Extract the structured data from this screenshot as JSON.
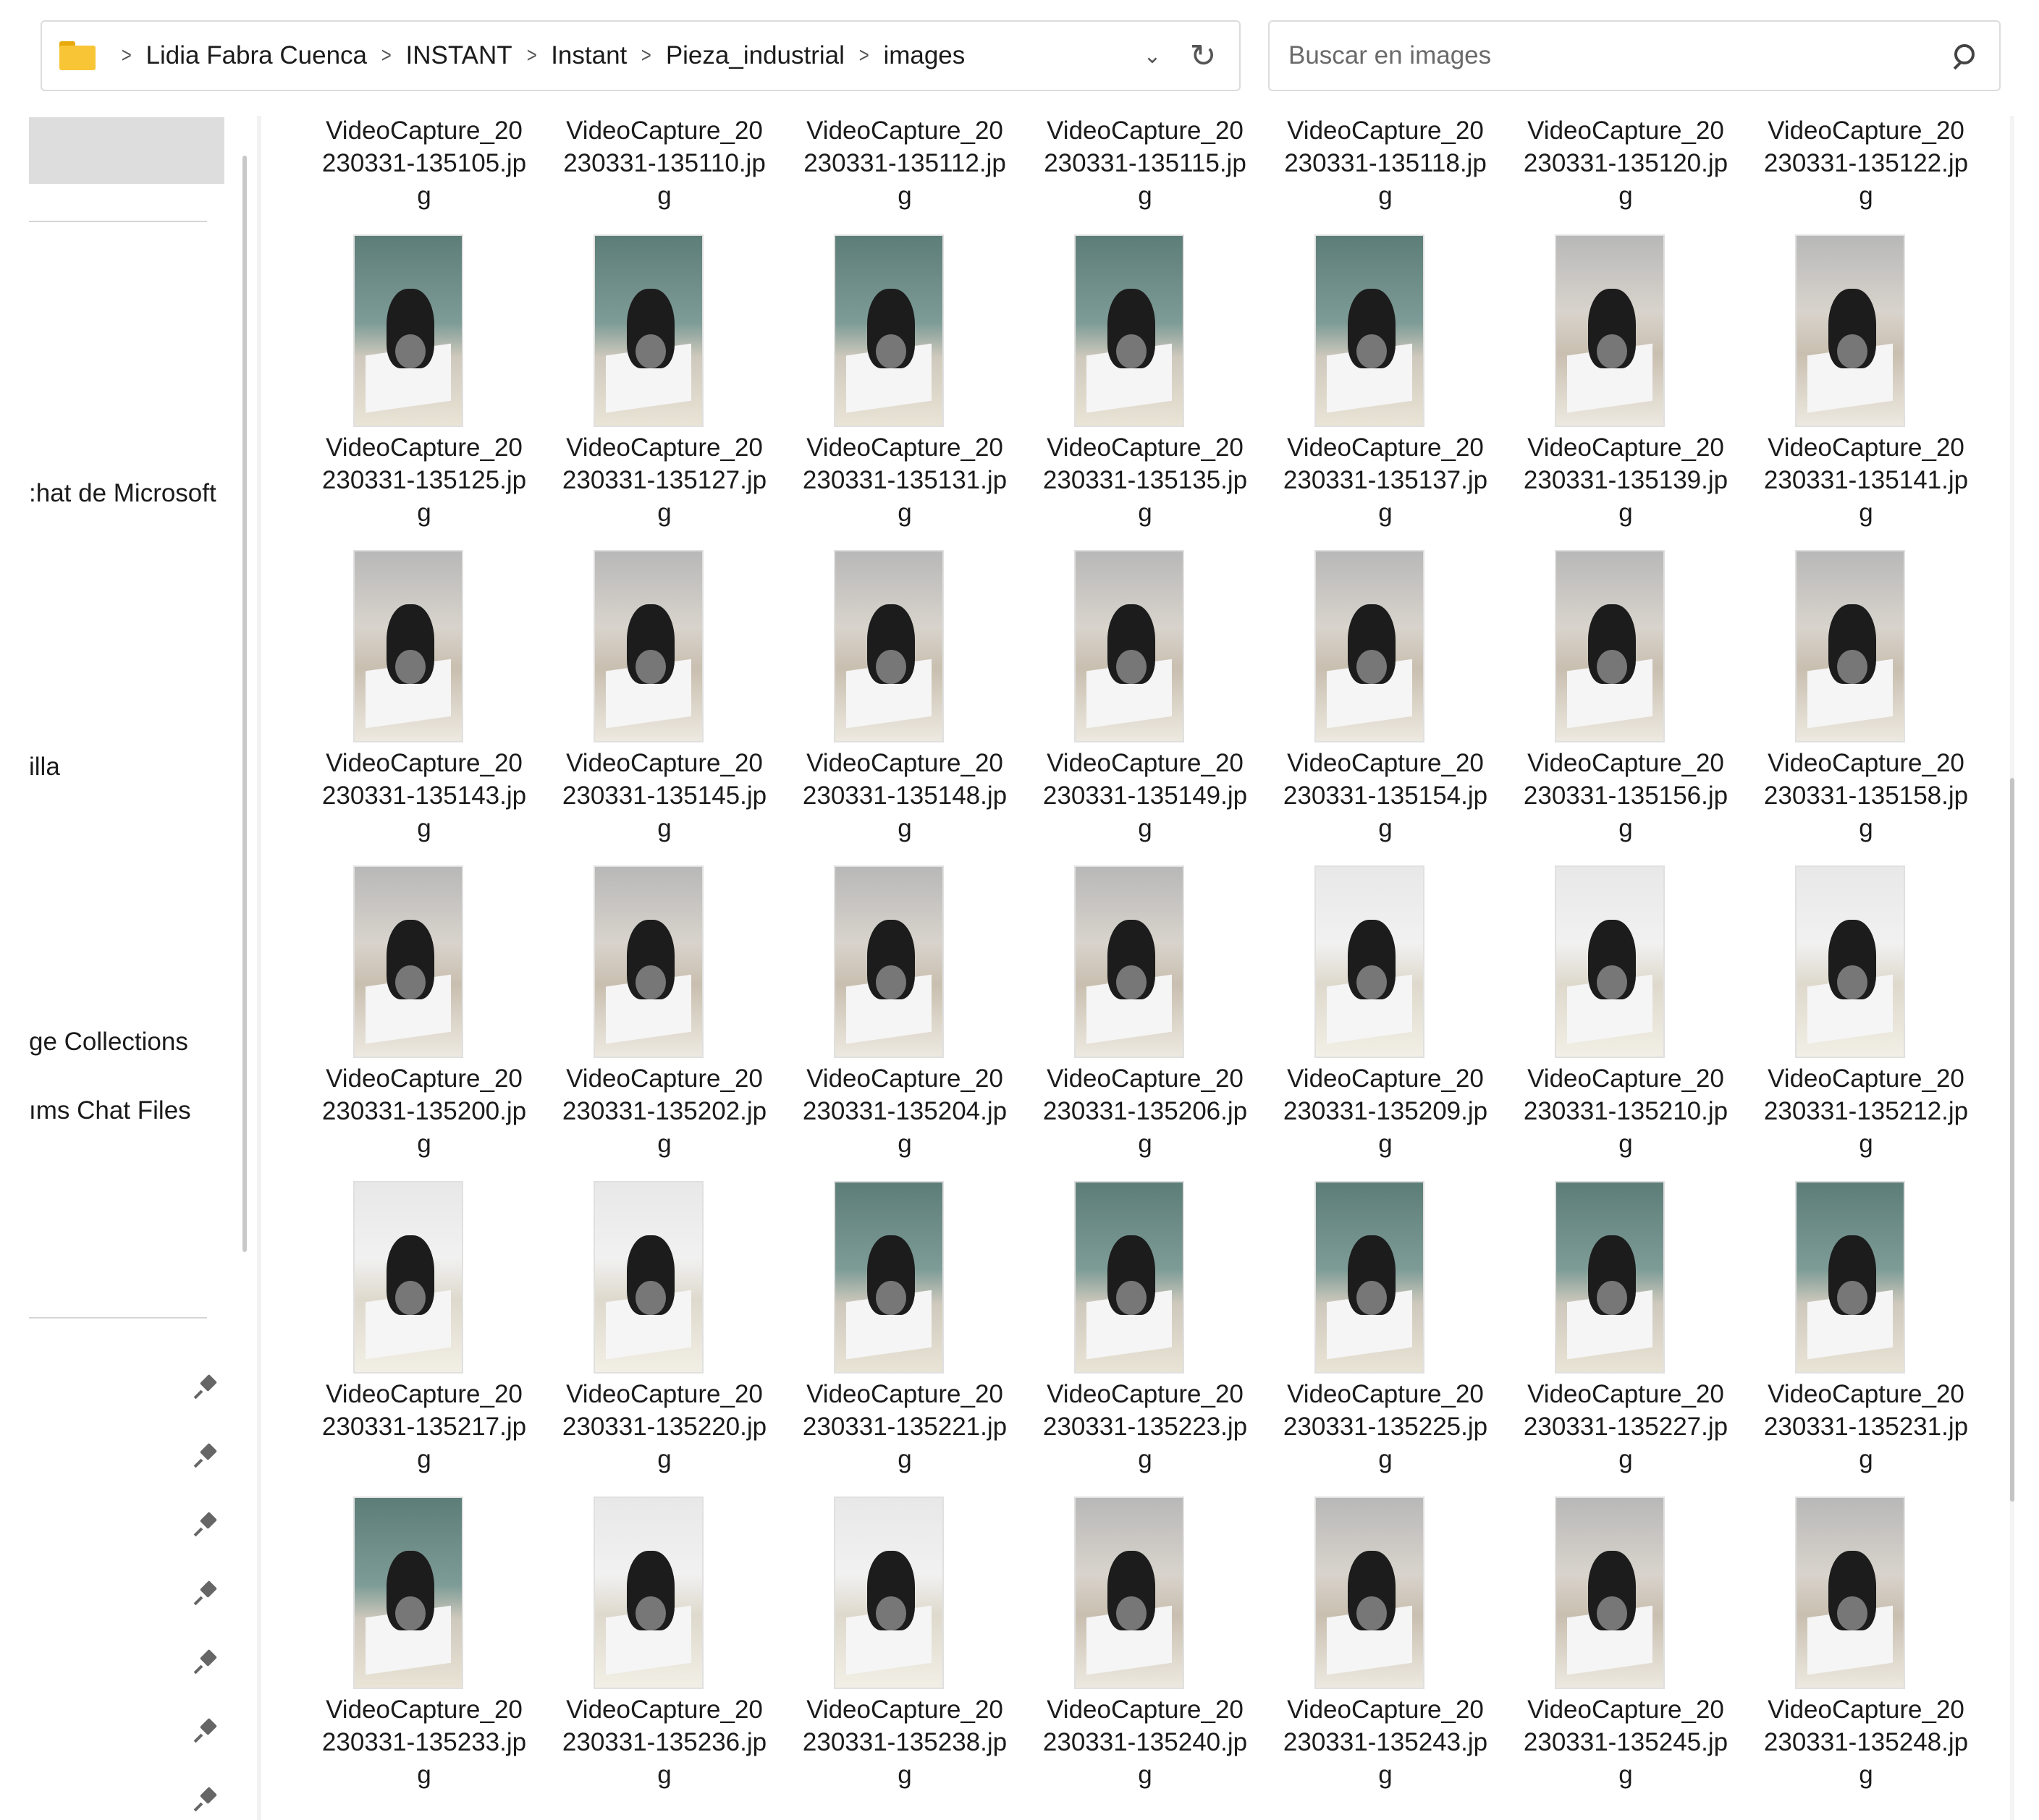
{
  "address": {
    "crumbs": [
      "Lidia Fabra Cuenca",
      "INSTANT",
      "Instant",
      "Pieza_industrial",
      "images"
    ]
  },
  "search": {
    "placeholder": "Buscar en images"
  },
  "sidebar": {
    "items": [
      {
        "label": ":hat de Microsoft",
        "top": 0
      },
      {
        "label": "illa",
        "top": 0
      },
      {
        "label": "ge Collections",
        "top": 0
      },
      {
        "label": "ıms Chat Files",
        "top": 0
      }
    ]
  },
  "files": {
    "top_row": [
      "VideoCapture_20\n230331-135105.jp\ng",
      "VideoCapture_20\n230331-135110.jp\ng",
      "VideoCapture_20\n230331-135112.jp\ng",
      "VideoCapture_20\n230331-135115.jp\ng",
      "VideoCapture_20\n230331-135118.jp\ng",
      "VideoCapture_20\n230331-135120.jp\ng",
      "VideoCapture_20\n230331-135122.jp\ng"
    ],
    "rows": [
      [
        "VideoCapture_20\n230331-135125.jp\ng",
        "VideoCapture_20\n230331-135127.jp\ng",
        "VideoCapture_20\n230331-135131.jp\ng",
        "VideoCapture_20\n230331-135135.jp\ng",
        "VideoCapture_20\n230331-135137.jp\ng",
        "VideoCapture_20\n230331-135139.jp\ng",
        "VideoCapture_20\n230331-135141.jp\ng"
      ],
      [
        "VideoCapture_20\n230331-135143.jp\ng",
        "VideoCapture_20\n230331-135145.jp\ng",
        "VideoCapture_20\n230331-135148.jp\ng",
        "VideoCapture_20\n230331-135149.jp\ng",
        "VideoCapture_20\n230331-135154.jp\ng",
        "VideoCapture_20\n230331-135156.jp\ng",
        "VideoCapture_20\n230331-135158.jp\ng"
      ],
      [
        "VideoCapture_20\n230331-135200.jp\ng",
        "VideoCapture_20\n230331-135202.jp\ng",
        "VideoCapture_20\n230331-135204.jp\ng",
        "VideoCapture_20\n230331-135206.jp\ng",
        "VideoCapture_20\n230331-135209.jp\ng",
        "VideoCapture_20\n230331-135210.jp\ng",
        "VideoCapture_20\n230331-135212.jp\ng"
      ],
      [
        "VideoCapture_20\n230331-135217.jp\ng",
        "VideoCapture_20\n230331-135220.jp\ng",
        "VideoCapture_20\n230331-135221.jp\ng",
        "VideoCapture_20\n230331-135223.jp\ng",
        "VideoCapture_20\n230331-135225.jp\ng",
        "VideoCapture_20\n230331-135227.jp\ng",
        "VideoCapture_20\n230331-135231.jp\ng"
      ],
      [
        "VideoCapture_20\n230331-135233.jp\ng",
        "VideoCapture_20\n230331-135236.jp\ng",
        "VideoCapture_20\n230331-135238.jp\ng",
        "VideoCapture_20\n230331-135240.jp\ng",
        "VideoCapture_20\n230331-135243.jp\ng",
        "VideoCapture_20\n230331-135245.jp\ng",
        "VideoCapture_20\n230331-135248.jp\ng"
      ]
    ]
  },
  "colors": {
    "folder": "#f8c537",
    "selected": "#dddddd",
    "border": "#dcdcdc"
  }
}
